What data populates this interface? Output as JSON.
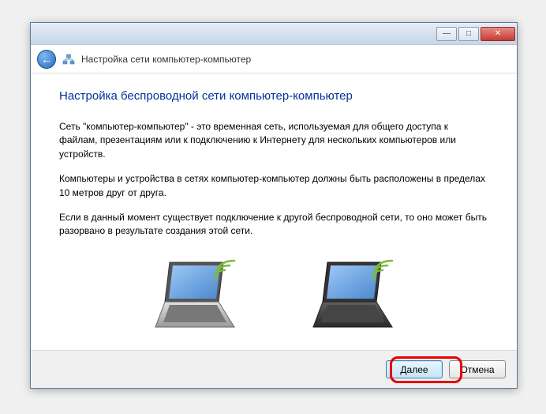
{
  "titlebar": {
    "minimize": "—",
    "maximize": "□",
    "close": "✕"
  },
  "header": {
    "back_arrow": "←",
    "title": "Настройка сети компьютер-компьютер"
  },
  "content": {
    "heading": "Настройка беспроводной сети компьютер-компьютер",
    "para1": "Сеть \"компьютер-компьютер\" - это временная сеть, используемая для общего доступа к файлам, презентациям или к подключению к Интернету для нескольких компьютеров или устройств.",
    "para2": "Компьютеры и устройства в сетях компьютер-компьютер должны быть расположены в пределах 10 метров друг от друга.",
    "para3": "Если в данный момент существует подключение к другой беспроводной сети, то оно может быть разорвано в результате создания этой сети."
  },
  "footer": {
    "next_label": "Далее",
    "cancel_label": "Отмена"
  }
}
